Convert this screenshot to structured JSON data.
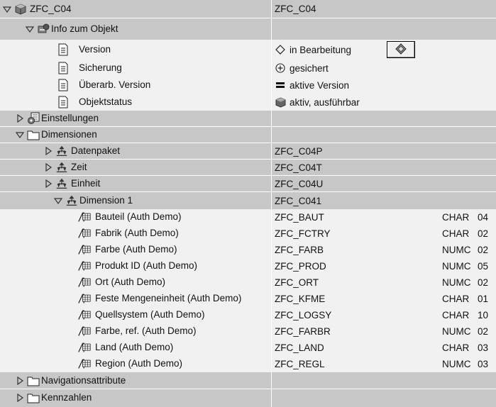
{
  "tree": {
    "root": {
      "label": "ZFC_C04",
      "technical_name": "ZFC_C04"
    },
    "info": {
      "label": "Info zum Objekt",
      "version": {
        "label": "Version",
        "value": "in Bearbeitung"
      },
      "sicherung": {
        "label": "Sicherung",
        "value": "gesichert"
      },
      "ueberarb": {
        "label": "Überarb. Version",
        "value": "aktive Version"
      },
      "objektstatus": {
        "label": "Objektstatus",
        "value": "aktiv, ausführbar"
      }
    },
    "einstellungen": {
      "label": "Einstellungen"
    },
    "dimensionen": {
      "label": "Dimensionen",
      "datenpaket": {
        "label": "Datenpaket",
        "technical_name": "ZFC_C04P"
      },
      "zeit": {
        "label": "Zeit",
        "technical_name": "ZFC_C04T"
      },
      "einheit": {
        "label": "Einheit",
        "technical_name": "ZFC_C04U"
      },
      "dimension1": {
        "label": "Dimension 1",
        "technical_name": "ZFC_C041",
        "characteristics": [
          {
            "label": "Bauteil (Auth Demo)",
            "technical_name": "ZFC_BAUT",
            "type": "CHAR",
            "length": "04"
          },
          {
            "label": "Fabrik (Auth Demo)",
            "technical_name": "ZFC_FCTRY",
            "type": "CHAR",
            "length": "02"
          },
          {
            "label": "Farbe (Auth Demo)",
            "technical_name": "ZFC_FARB",
            "type": "NUMC",
            "length": "02"
          },
          {
            "label": "Produkt ID (Auth Demo)",
            "technical_name": "ZFC_PROD",
            "type": "NUMC",
            "length": "05"
          },
          {
            "label": "Ort (Auth Demo)",
            "technical_name": "ZFC_ORT",
            "type": "NUMC",
            "length": "02"
          },
          {
            "label": "Feste Mengeneinheit (Auth Demo)",
            "technical_name": "ZFC_KFME",
            "type": "CHAR",
            "length": "01"
          },
          {
            "label": "Quellsystem (Auth Demo)",
            "technical_name": "ZFC_LOGSY",
            "type": "CHAR",
            "length": "10"
          },
          {
            "label": "Farbe, ref. (Auth Demo)",
            "technical_name": "ZFC_FARBR",
            "type": "NUMC",
            "length": "02"
          },
          {
            "label": "Land (Auth Demo)",
            "technical_name": "ZFC_LAND",
            "type": "CHAR",
            "length": "03"
          },
          {
            "label": "Region (Auth Demo)",
            "technical_name": "ZFC_REGL",
            "type": "NUMC",
            "length": "03"
          }
        ]
      }
    },
    "navigationsattribute": {
      "label": "Navigationsattribute"
    },
    "kennzahlen": {
      "label": "Kennzahlen"
    }
  },
  "colors": {
    "row_dark": "#dcdcdc",
    "row_light": "#f1f1f1",
    "row_selected": "#c7c7c7",
    "separator": "#ffffff"
  },
  "icons": {
    "collapse": "triangle-down-icon",
    "expand": "triangle-right-icon",
    "infocube": "infocube-icon",
    "info": "info-object-icon",
    "document": "document-icon",
    "settings": "settings-icon",
    "folder": "folder-icon",
    "dimension": "dimension-icon",
    "characteristic": "characteristic-icon",
    "diamond": "diamond-icon",
    "saved": "plus-circle-icon",
    "active_version": "equals-icon",
    "active": "active-cube-icon",
    "activate": "activate-icon"
  }
}
